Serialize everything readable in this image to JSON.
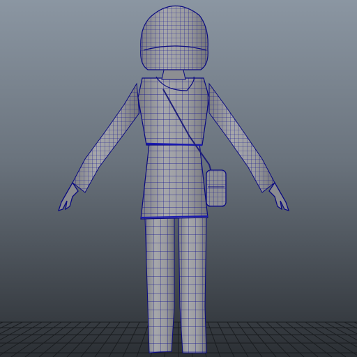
{
  "viewport": {
    "background_top": "#8c97a3",
    "background_bottom": "#2a2e33",
    "grid_color": "#1a1d20",
    "mesh_fill": "#9a9b9f",
    "mesh_shadow": "#6f7075",
    "wireframe_color": "#0a0a8a",
    "wireframe_highlight": "#2020c0"
  },
  "model": {
    "name_icon": "character-mesh",
    "parts": [
      "hair",
      "head",
      "torso",
      "left-arm",
      "right-arm",
      "left-hand",
      "right-hand",
      "skirt",
      "left-leg",
      "right-leg",
      "shoulder-bag"
    ]
  }
}
